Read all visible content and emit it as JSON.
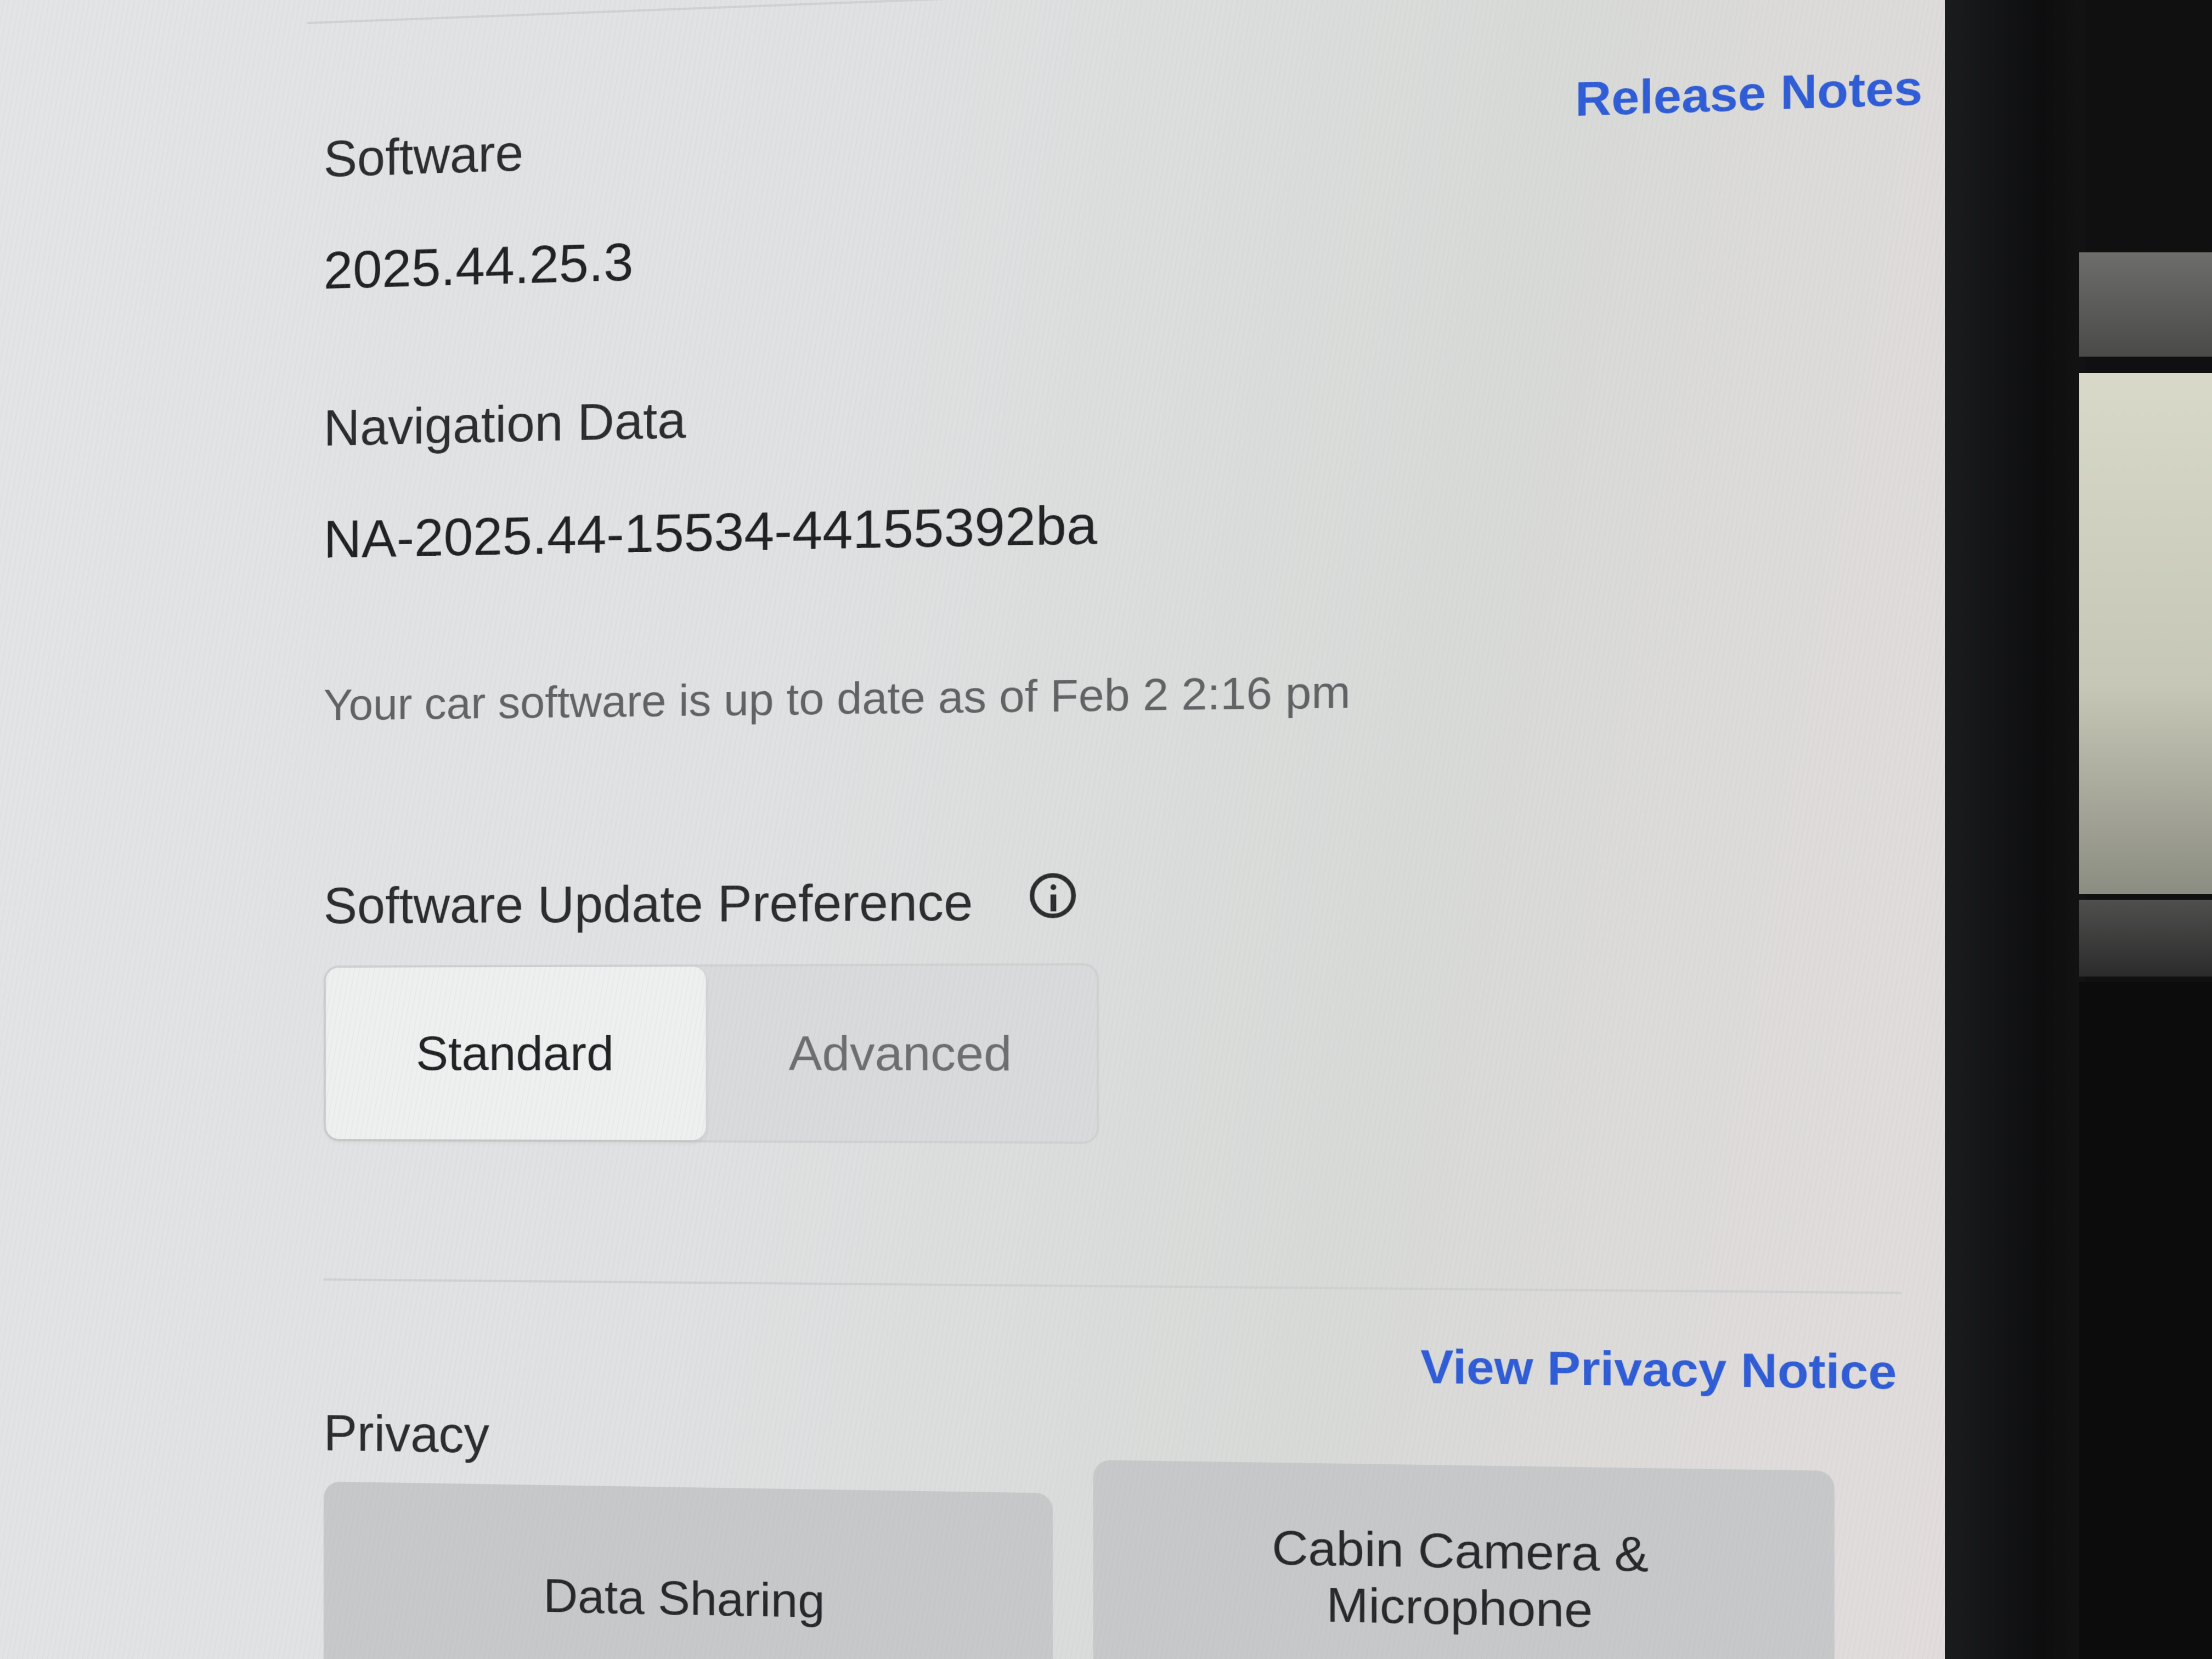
{
  "software": {
    "title": "Software",
    "release_notes_label": "Release Notes",
    "version": "2025.44.25.3"
  },
  "navigation_data": {
    "title": "Navigation Data",
    "value": "NA-2025.44-15534-44155392ba"
  },
  "update_status": "Your car software is up to date as of Feb 2 2:16 pm",
  "update_preference": {
    "title": "Software Update Preference",
    "info_icon": "info-icon",
    "options": [
      "Standard",
      "Advanced"
    ],
    "selected": "Standard"
  },
  "privacy": {
    "title": "Privacy",
    "notice_label": "View Privacy Notice",
    "buttons": {
      "data_sharing": "Data Sharing",
      "cabin_camera_line1": "Cabin Camera &",
      "cabin_camera_line2": "Microphone"
    }
  },
  "colors": {
    "link": "#2e5bd6",
    "screen_bg": "#e0e2e2",
    "tile_bg": "#c6c8c9"
  }
}
